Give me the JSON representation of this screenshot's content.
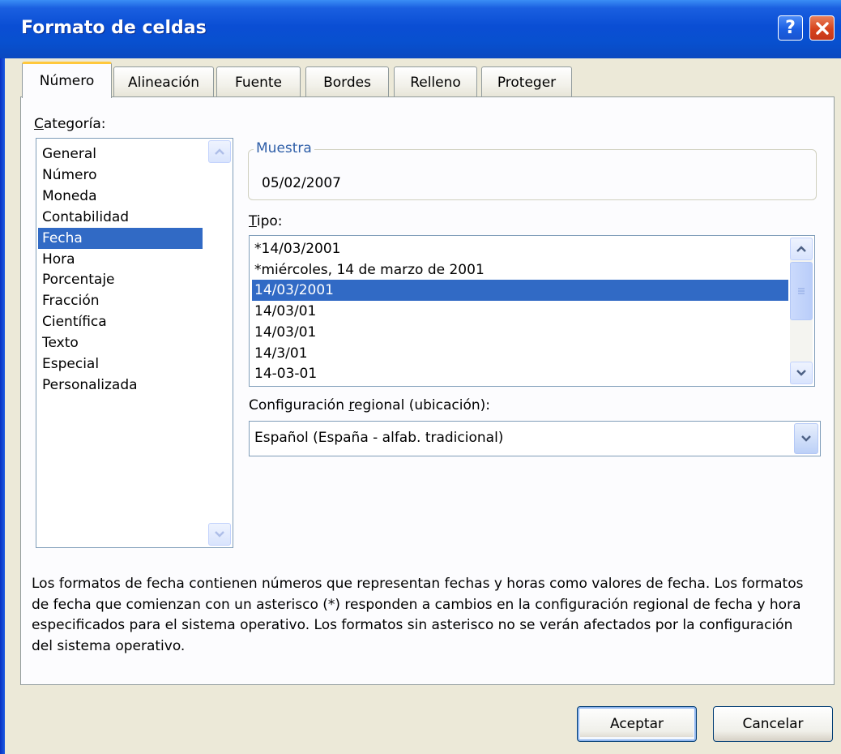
{
  "window": {
    "title": "Formato de celdas"
  },
  "titlebar_buttons": {
    "help_label": "?"
  },
  "tabs": [
    {
      "label": "Número",
      "active": true
    },
    {
      "label": "Alineación",
      "active": false
    },
    {
      "label": "Fuente",
      "active": false
    },
    {
      "label": "Bordes",
      "active": false
    },
    {
      "label": "Relleno",
      "active": false
    },
    {
      "label": "Proteger",
      "active": false
    }
  ],
  "category": {
    "label": "Categoría:",
    "items": [
      "General",
      "Número",
      "Moneda",
      "Contabilidad",
      "Fecha",
      "Hora",
      "Porcentaje",
      "Fracción",
      "Científica",
      "Texto",
      "Especial",
      "Personalizada"
    ],
    "selected": "Fecha"
  },
  "sample": {
    "label": "Muestra",
    "value": "05/02/2007"
  },
  "tipo": {
    "label": "Tipo:",
    "items": [
      "*14/03/2001",
      "*miércoles, 14 de marzo de 2001",
      "14/03/2001",
      "14/03/01",
      "14/03/01",
      "14/3/01",
      "14-03-01"
    ],
    "selected_index": 2
  },
  "locale": {
    "label": "Configuración regional (ubicación):",
    "value": "Español (España - alfab. tradicional)"
  },
  "description": "Los formatos de fecha contienen números que representan fechas y horas como valores de fecha. Los formatos de fecha que comienzan con un asterisco (*) responden a cambios en la configuración regional de fecha y hora especificados para el sistema operativo. Los formatos sin asterisco no se verán afectados por la configuración del sistema operativo.",
  "buttons": {
    "ok": "Aceptar",
    "cancel": "Cancelar"
  },
  "colors": {
    "selection": "#316ac5",
    "titlebar": "#0a4ed4",
    "dialog_bg": "#ece9d8",
    "tab_highlight": "#ffc83c"
  },
  "icons": [
    "help-icon",
    "close-icon",
    "scroll-up-icon",
    "scroll-down-icon",
    "scroll-grip-icon",
    "dropdown-arrow-icon"
  ]
}
